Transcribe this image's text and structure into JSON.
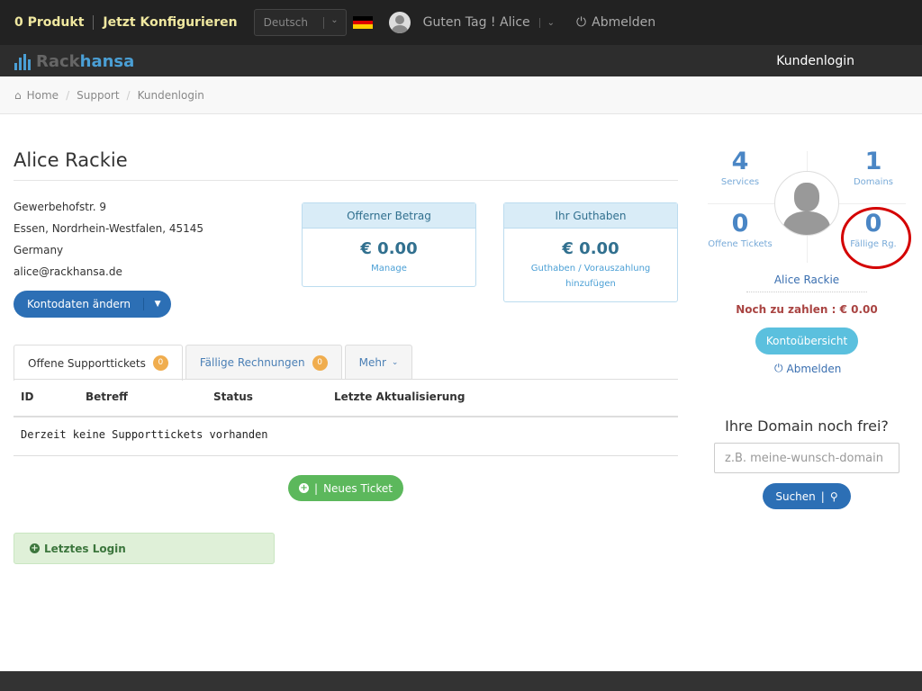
{
  "topbar": {
    "products": "0 Produkt",
    "configure": "Jetzt Konfigurieren",
    "language": "Deutsch",
    "greeting": "Guten Tag ! Alice",
    "logout": "Abmelden"
  },
  "navbar": {
    "logo_rack": "Rack",
    "logo_hansa": "hansa",
    "kundenlogin": "Kundenlogin"
  },
  "breadcrumb": [
    "Home",
    "Support",
    "Kundenlogin"
  ],
  "profile": {
    "name": "Alice Rackie",
    "street": "Gewerbehofstr. 9",
    "city": "Essen, Nordrhein-Westfalen, 45145",
    "country": "Germany",
    "email": "alice@rackhansa.de",
    "edit_button": "Kontodaten ändern"
  },
  "open_amount": {
    "header": "Offerner Betrag",
    "amount": "€ 0.00",
    "link": "Manage"
  },
  "credit": {
    "header": "Ihr Guthaben",
    "amount": "€ 0.00",
    "link1": "Guthaben / Vorauszahlung",
    "link2": "hinzufügen"
  },
  "tabs": [
    {
      "label": "Offene Supporttickets",
      "count": "0"
    },
    {
      "label": "Fällige Rechnungen",
      "count": "0"
    },
    {
      "label": "Mehr"
    }
  ],
  "table": {
    "headers": [
      "ID",
      "Betreff",
      "Status",
      "Letzte Aktualisierung"
    ],
    "empty": "Derzeit keine Supporttickets vorhanden"
  },
  "new_ticket": "Neues Ticket",
  "last_login": "Letztes Login",
  "stats": {
    "services": {
      "num": "4",
      "label": "Services"
    },
    "domains": {
      "num": "1",
      "label": "Domains"
    },
    "tickets": {
      "num": "0",
      "label": "Offene Tickets"
    },
    "due": {
      "num": "0",
      "label": "Fällige Rg."
    }
  },
  "sidebar": {
    "name": "Alice Rackie",
    "due_text": "Noch zu zahlen : € 0.00",
    "overview_button": "Kontoübersicht",
    "logout": "Abmelden"
  },
  "domain_search": {
    "title": "Ihre Domain noch frei?",
    "placeholder": "z.B. meine-wunsch-domain",
    "button": "Suchen"
  },
  "colors": {
    "primary": "#2c6fb5",
    "success": "#5cb85c",
    "info": "#5bc0de",
    "annotation": "#d40000"
  }
}
